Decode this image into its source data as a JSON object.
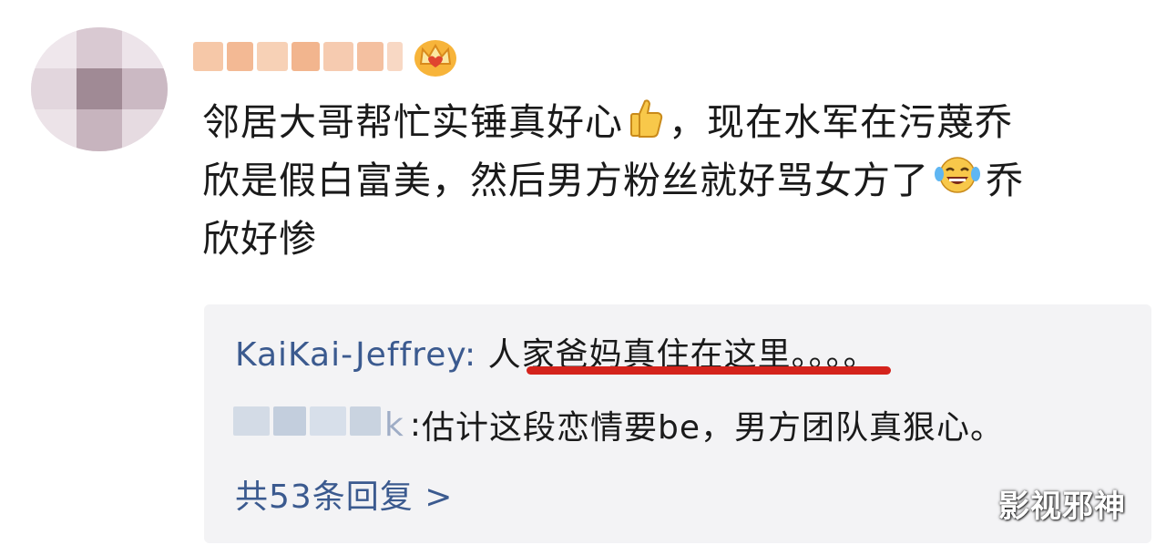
{
  "comment": {
    "line1_part1": "邻居大哥帮忙实锤真好心",
    "line1_part2": "，现在水军在污蔑乔",
    "line2_part1": "欣是假白富美，然后男方粉丝就好骂女方了",
    "line2_part2": "乔",
    "line3": "欣好惨",
    "emoji1": "thumbs-up-icon",
    "emoji2": "laughing-tears-icon"
  },
  "replies": [
    {
      "user": "KaiKai-Jeffrey",
      "separator": ": ",
      "text": "人家爸妈真住在这里",
      "trail": "。。。。"
    },
    {
      "user_suffix": "k",
      "separator": ": ",
      "text": "估计这段恋情要be，男方团队真狠心。"
    }
  ],
  "reply_count": "共53条回复 >",
  "watermark": "影视邪神",
  "colors": {
    "link": "#3b5a8f",
    "highlight": "#d4231c",
    "reply_bg": "#f3f3f5"
  }
}
